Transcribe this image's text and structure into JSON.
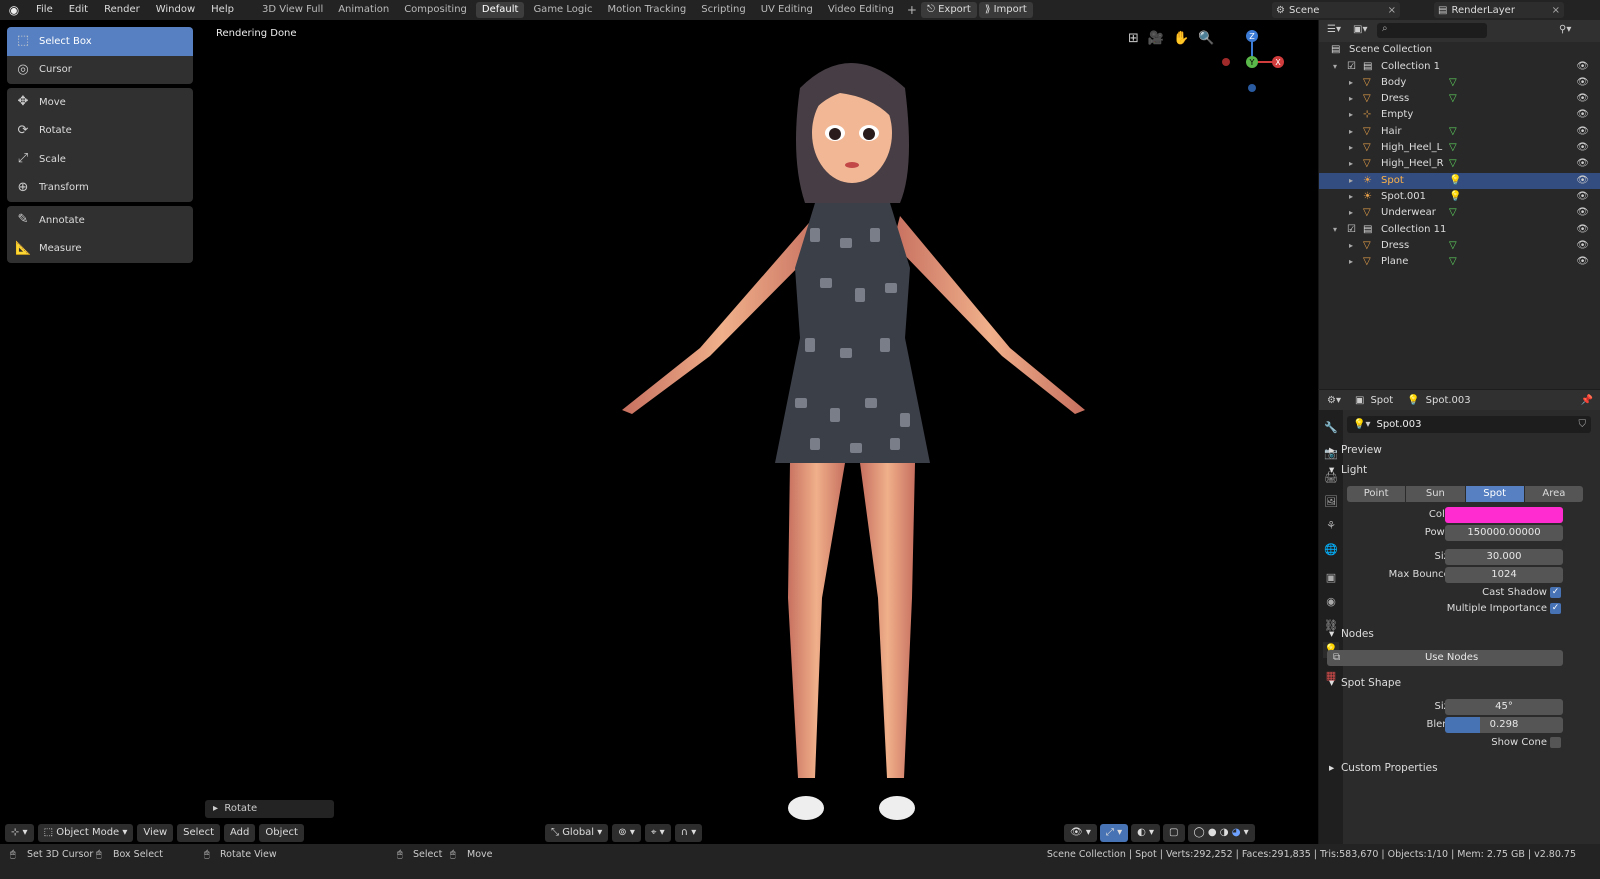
{
  "topbar": {
    "menus": [
      "File",
      "Edit",
      "Render",
      "Window",
      "Help"
    ],
    "workspaces": [
      "3D View Full",
      "Animation",
      "Compositing",
      "Default",
      "Game Logic",
      "Motion Tracking",
      "Scripting",
      "UV Editing",
      "Video Editing"
    ],
    "active_workspace": "Default",
    "export_label": "Export",
    "import_label": "Import",
    "scene": "Scene",
    "render_layer": "RenderLayer"
  },
  "viewport": {
    "status_text": "Rendering Done",
    "tools": [
      "Select Box",
      "Cursor",
      "Move",
      "Rotate",
      "Scale",
      "Transform",
      "Annotate",
      "Measure"
    ],
    "active_tool": "Select Box",
    "last_op": "Rotate",
    "mode": "Object Mode",
    "header_menus": [
      "View",
      "Select",
      "Add",
      "Object"
    ],
    "orientation": "Global",
    "gizmo": {
      "z": "Z",
      "y": "Y",
      "x": "X"
    }
  },
  "outliner": {
    "root": "Scene Collection",
    "items": [
      {
        "name": "Collection 1",
        "kind": "collection"
      },
      {
        "name": "Body",
        "kind": "mesh"
      },
      {
        "name": "Dress",
        "kind": "mesh"
      },
      {
        "name": "Empty",
        "kind": "empty"
      },
      {
        "name": "Hair",
        "kind": "mesh"
      },
      {
        "name": "High_Heel_L",
        "kind": "mesh"
      },
      {
        "name": "High_Heel_R",
        "kind": "mesh"
      },
      {
        "name": "Spot",
        "kind": "light",
        "selected": true
      },
      {
        "name": "Spot.001",
        "kind": "light"
      },
      {
        "name": "Underwear",
        "kind": "mesh"
      },
      {
        "name": "Collection 11",
        "kind": "collection"
      },
      {
        "name": "Dress",
        "kind": "mesh"
      },
      {
        "name": "Plane",
        "kind": "mesh"
      }
    ]
  },
  "properties": {
    "object_name": "Spot",
    "data_name": "Spot.003",
    "datablock": "Spot.003",
    "panels": {
      "preview": "Preview",
      "light": "Light",
      "nodes": "Nodes",
      "spot_shape": "Spot Shape",
      "custom": "Custom Properties"
    },
    "light_types": [
      "Point",
      "Sun",
      "Spot",
      "Area"
    ],
    "active_type": "Spot",
    "color_label": "Color",
    "color": "#ff2ccf",
    "power_label": "Power",
    "power": "150000.00000",
    "size_label": "Size",
    "size": "30.000",
    "bounces_label": "Max Bounces",
    "bounces": "1024",
    "cast_shadow_label": "Cast Shadow",
    "multi_imp_label": "Multiple Importance",
    "use_nodes": "Use Nodes",
    "spot_size_label": "Size",
    "spot_size": "45°",
    "blend_label": "Blend",
    "blend": "0.298",
    "blend_fraction": 0.298,
    "show_cone_label": "Show Cone"
  },
  "statusbar": {
    "left": [
      "Set 3D Cursor",
      "Box Select",
      "Rotate View",
      "Select",
      "Move"
    ],
    "right": "Scene Collection | Spot | Verts:292,252 | Faces:291,835 | Tris:583,670 | Objects:1/10 | Mem: 2.75 GB | v2.80.75"
  },
  "colors": {
    "accent": "#5680c2",
    "selection": "#334d80",
    "mesh": "#e8a04a",
    "light": "#5fd65f"
  }
}
